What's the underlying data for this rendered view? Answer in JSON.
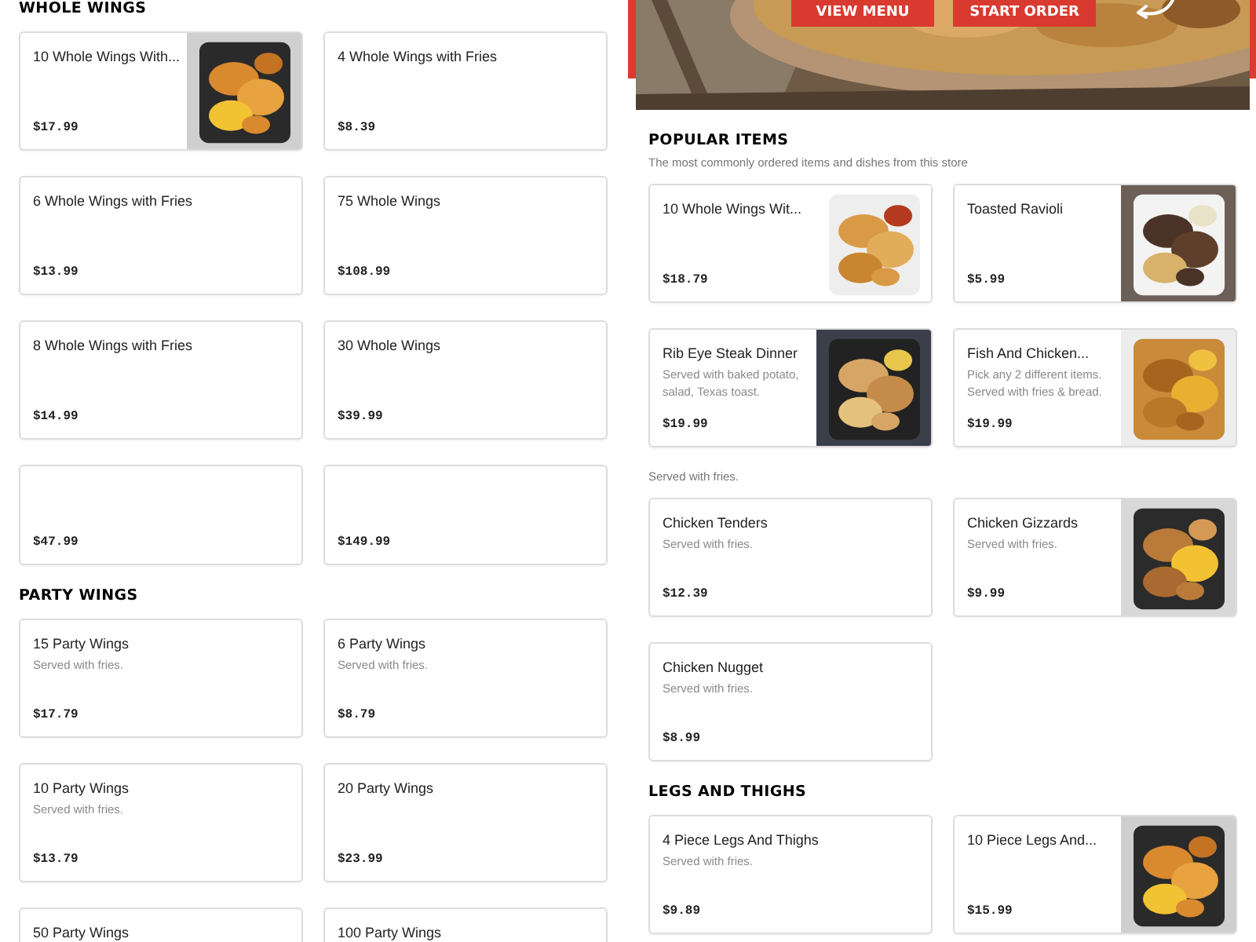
{
  "hero": {
    "buttons": [
      "VIEW MENU",
      "START ORDER"
    ],
    "picture": {
      "kind": "picture"
    }
  },
  "left": {
    "sections": [
      {
        "title": "WHOLE WINGS",
        "items": [
          {
            "title": "10 Whole Wings With...",
            "price": "$17.99",
            "kind": "picture"
          },
          {
            "title": "4 Whole Wings with Fries",
            "price": "$8.39",
            "kind": "plain"
          },
          {
            "title": "6 Whole Wings with Fries",
            "price": "$13.99",
            "kind": "plain"
          },
          {
            "title": "75 Whole Wings",
            "price": "$108.99",
            "kind": "plain"
          },
          {
            "title": "8 Whole Wings with Fries",
            "price": "$14.99",
            "kind": "plain"
          },
          {
            "title": "30 Whole Wings",
            "price": "$39.99",
            "kind": "plain"
          },
          {
            "price": "$47.99",
            "kind": "short"
          },
          {
            "price": "$149.99",
            "kind": "short"
          }
        ]
      },
      {
        "title": "PARTY WINGS",
        "items": [
          {
            "title": "15 Party Wings",
            "description": "Served with fries.",
            "price": "$17.79",
            "kind": "plain"
          },
          {
            "title": "6 Party Wings",
            "description": "Served with fries.",
            "price": "$8.79",
            "kind": "plain"
          },
          {
            "title": "10 Party Wings",
            "description": "Served with fries.",
            "price": "$13.79",
            "kind": "plain"
          },
          {
            "title": "20 Party Wings",
            "price": "$23.99",
            "kind": "plain"
          },
          {
            "title": "50 Party Wings",
            "kind": "plain"
          },
          {
            "title": "100 Party Wings",
            "kind": "plain"
          }
        ]
      }
    ]
  },
  "right": {
    "sections": [
      {
        "title": "POPULAR ITEMS",
        "subtitle": "The most commonly ordered items and dishes from this store",
        "items": [
          {
            "title": "10 Whole Wings Wit...",
            "price": "$18.79",
            "kind": "picture"
          },
          {
            "title": "Toasted Ravioli",
            "price": "$5.99",
            "kind": "picture"
          },
          {
            "title": "Rib Eye Steak Dinner",
            "description": "Served with baked potato, salad, Texas toast.",
            "price": "$19.99",
            "kind": "picture"
          },
          {
            "title": "Fish And Chicken...",
            "description": "Pick any 2 different items. Served with fries & bread.",
            "price": "$19.99",
            "kind": "picture"
          }
        ]
      },
      {
        "subtitle": "Served with fries.",
        "items": [
          {
            "title": "Chicken Tenders",
            "description": "Served with fries.",
            "price": "$12.39",
            "kind": "plain"
          },
          {
            "title": "Chicken Gizzards",
            "description": "Served with fries.",
            "price": "$9.99",
            "kind": "picture"
          },
          {
            "title": "Chicken Nugget",
            "description": "Served with fries.",
            "price": "$8.99",
            "kind": "plain"
          }
        ]
      },
      {
        "title": "LEGS AND THIGHS",
        "items": [
          {
            "title": "4 Piece Legs And Thighs",
            "description": "Served with fries.",
            "price": "$9.89",
            "kind": "plain"
          },
          {
            "title": "10 Piece Legs And...",
            "price": "$15.99",
            "kind": "picture"
          }
        ]
      }
    ]
  }
}
